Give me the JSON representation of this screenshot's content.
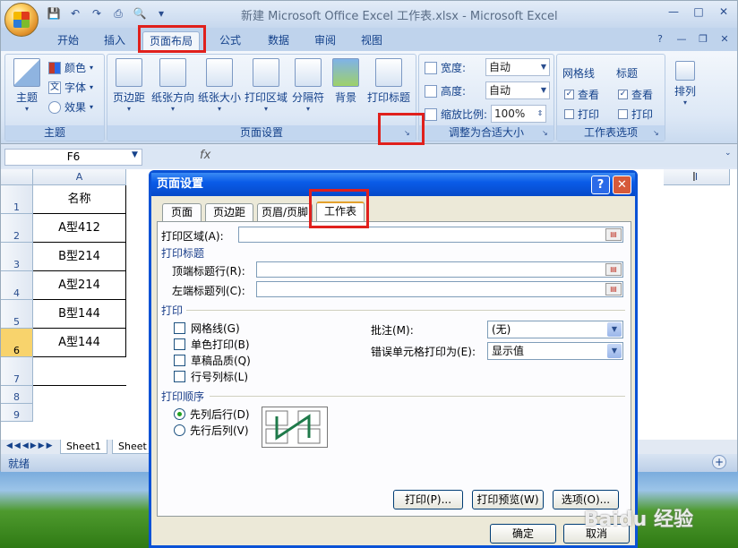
{
  "window": {
    "title": "新建 Microsoft Office Excel 工作表.xlsx - Microsoft Excel"
  },
  "ribbon_tabs": [
    "开始",
    "插入",
    "页面布局",
    "公式",
    "数据",
    "审阅",
    "视图"
  ],
  "ribbon": {
    "theme_group": {
      "label": "主题",
      "theme_btn": "主题",
      "colors": "颜色",
      "fonts": "字体",
      "effects": "效果"
    },
    "page_setup_group": {
      "label": "页面设置",
      "buttons": [
        "页边距",
        "纸张方向",
        "纸张大小",
        "打印区域",
        "分隔符",
        "背景",
        "打印标题"
      ]
    },
    "scale_group": {
      "label": "调整为合适大小",
      "width_label": "宽度:",
      "width_value": "自动",
      "height_label": "高度:",
      "height_value": "自动",
      "scale_label": "缩放比例:",
      "scale_value": "100%"
    },
    "sheet_options_group": {
      "label": "工作表选项",
      "gridlines": "网格线",
      "headings": "标题",
      "view": "查看",
      "print": "打印"
    },
    "arrange_group": {
      "label": "排列"
    }
  },
  "formula_bar": {
    "name_box": "F6",
    "fx": "fx"
  },
  "grid": {
    "columns": [
      "A",
      "I"
    ],
    "rows": [
      {
        "num": "1",
        "a": "名称"
      },
      {
        "num": "2",
        "a": "A型412"
      },
      {
        "num": "3",
        "a": "B型214"
      },
      {
        "num": "4",
        "a": "A型214"
      },
      {
        "num": "5",
        "a": "B型144"
      },
      {
        "num": "6",
        "a": "A型144"
      },
      {
        "num": "7",
        "a": ""
      },
      {
        "num": "8",
        "a": ""
      },
      {
        "num": "9",
        "a": ""
      }
    ],
    "sheet_tabs": [
      "Sheet1",
      "Sheet"
    ],
    "status": "就绪"
  },
  "dialog": {
    "title": "页面设置",
    "tabs": [
      "页面",
      "页边距",
      "页眉/页脚",
      "工作表"
    ],
    "print_area_label": "打印区域(A):",
    "print_titles_section": "打印标题",
    "rows_to_repeat_label": "顶端标题行(R):",
    "cols_to_repeat_label": "左端标题列(C):",
    "print_section": "打印",
    "checks": [
      "网格线(G)",
      "单色打印(B)",
      "草稿品质(Q)",
      "行号列标(L)"
    ],
    "comments_label": "批注(M):",
    "comments_value": "(无)",
    "errors_label": "错误单元格打印为(E):",
    "errors_value": "显示值",
    "order_section": "打印顺序",
    "order_options": [
      "先列后行(D)",
      "先行后列(V)"
    ],
    "buttons": {
      "print": "打印(P)...",
      "preview": "打印预览(W)",
      "options": "选项(O)...",
      "ok": "确定",
      "cancel": "取消"
    }
  },
  "watermark": "Baidu 经验"
}
